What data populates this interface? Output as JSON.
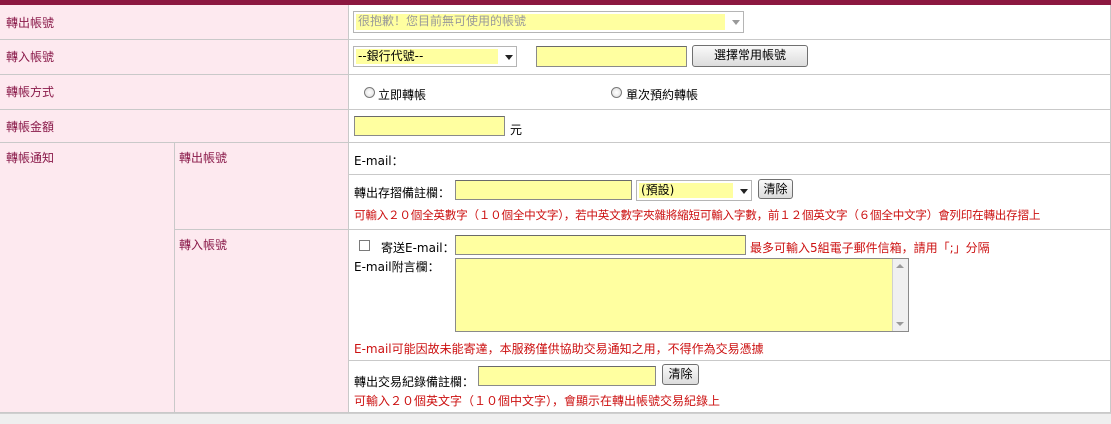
{
  "rows": {
    "from_account": {
      "label": "轉出帳號",
      "select_value": "很抱歉！您目前無可使用的帳號"
    },
    "to_account": {
      "label": "轉入帳號",
      "bank_select_value": "--銀行代號--",
      "account_input_value": "",
      "choose_button": "選擇常用帳號"
    },
    "method": {
      "label": "轉帳方式",
      "option_immediate": "立即轉帳",
      "option_scheduled": "單次預約轉帳"
    },
    "amount": {
      "label": "轉帳金額",
      "input_value": "",
      "unit": "元"
    },
    "notify": {
      "label": "轉帳通知",
      "from_section": {
        "label": "轉出帳號",
        "email_label": "E-mail：",
        "passbook_note_label": "轉出存摺備註欄：",
        "passbook_note_value": "",
        "preset_select_value": "(預設)",
        "clear_button": "清除",
        "passbook_hint": "可輸入２０個全英數字（１０個全中文字），若中英文數字夾雜將縮短可輸入字數，前１２個英文字（６個全中文字）會列印在轉出存摺上"
      },
      "to_section": {
        "label": "轉入帳號",
        "send_email_label": "寄送E-mail：",
        "send_email_checked": false,
        "email_value": "",
        "email_hint": "最多可輸入5組電子郵件信箱，請用「;」分隔",
        "message_label": "E-mail附言欄：",
        "message_value": "",
        "disclaimer": "E-mail可能因故未能寄達，本服務僅供協助交易通知之用，不得作為交易憑據"
      },
      "record_note": {
        "label": "轉出交易紀錄備註欄：",
        "value": "",
        "clear_button": "清除",
        "hint": "可輸入２０個英文字（１０個中文字），會顯示在轉出帳號交易紀錄上"
      }
    }
  },
  "colors": {
    "accent": "#8c1840",
    "label_bg": "#fde9ef",
    "label_text": "#8a1a4a",
    "input_bg": "#ffffa0",
    "hint_text": "#cc1111"
  }
}
